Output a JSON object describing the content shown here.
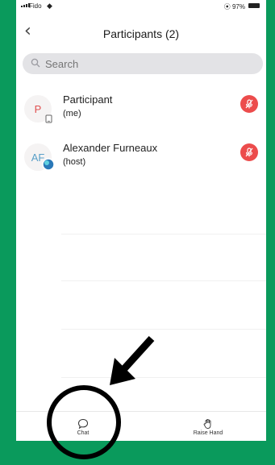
{
  "status_bar": {
    "carrier": "Fido",
    "battery_pct": "97%"
  },
  "header": {
    "title": "Participants (2)"
  },
  "search": {
    "placeholder": "Search"
  },
  "participants": [
    {
      "initials": "P",
      "name": "Participant",
      "role": "(me)",
      "initials_color": "#e05050"
    },
    {
      "initials": "AF",
      "name": "Alexander Furneaux",
      "role": "(host)",
      "initials_color": "#5aa0c8"
    }
  ],
  "bottom_bar": {
    "chat_label": "Chat",
    "raise_hand_label": "Raise Hand"
  },
  "colors": {
    "background": "#0a9a5c",
    "mute_red": "#ec4c4c"
  },
  "icons": [
    "back-chevron-icon",
    "search-icon",
    "microphone-muted-icon",
    "chat-bubble-icon",
    "raise-hand-icon",
    "phone-device-icon",
    "annotation-arrow",
    "annotation-circle"
  ]
}
